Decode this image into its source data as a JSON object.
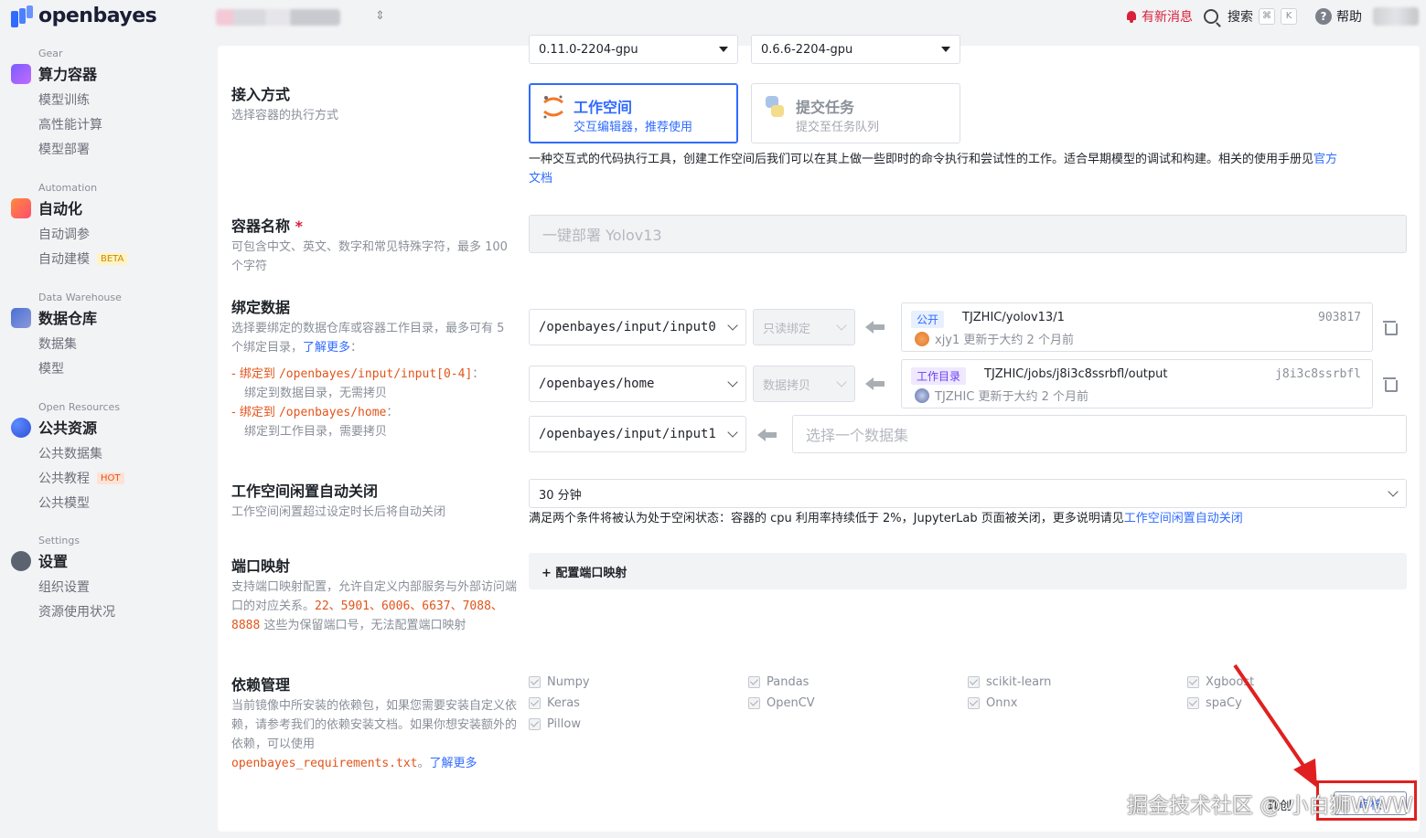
{
  "topbar": {
    "logo_text": "openbayes",
    "notify": "有新消息",
    "search": "搜索",
    "kbd_cmd": "⌘",
    "kbd_k": "K",
    "help": "帮助"
  },
  "sidebar": {
    "gear": {
      "caption": "Gear",
      "title": "算力容器",
      "items": [
        "模型训练",
        "高性能计算",
        "模型部署"
      ]
    },
    "automation": {
      "caption": "Automation",
      "title": "自动化",
      "items": [
        "自动调参",
        "自动建模"
      ],
      "beta": "BETA"
    },
    "warehouse": {
      "caption": "Data Warehouse",
      "title": "数据仓库",
      "items": [
        "数据集",
        "模型"
      ]
    },
    "open": {
      "caption": "Open Resources",
      "title": "公共资源",
      "items": [
        "公共数据集",
        "公共教程",
        "公共模型"
      ],
      "hot": "HOT"
    },
    "settings": {
      "caption": "Settings",
      "title": "设置",
      "items": [
        "组织设置",
        "资源使用状况"
      ]
    }
  },
  "form": {
    "versions": [
      "0.11.0-2204-gpu",
      "0.6.6-2204-gpu"
    ],
    "access": {
      "label": "接入方式",
      "desc": "选择容器的执行方式",
      "workspace_title": "工作空间",
      "workspace_sub": "交互编辑器，推荐使用",
      "task_title": "提交任务",
      "task_sub": "提交至任务队列",
      "note": "一种交互式的代码执行工具，创建工作空间后我们可以在其上做一些即时的命令执行和尝试性的工作。适合早期模型的调试和构建。相关的使用手册见",
      "note_link": "官方",
      "note_link2": "文档"
    },
    "name": {
      "label": "容器名称",
      "required": "*",
      "desc": "可包含中文、英文、数字和常见特殊字符，最多 100 个字符",
      "placeholder": "一键部署 Yolov13"
    },
    "bind": {
      "label": "绑定数据",
      "desc_1": "选择要绑定的数据仓库或容器工作目录，最多可有 5 个绑定目录，",
      "learn_more": "了解更多",
      "colon": "：",
      "rule1_prefix": "- 绑定到 ",
      "rule1_path": "/openbayes/input/input[0-4]",
      "rule1_suffix": "：",
      "rule1_desc": "绑定到数据目录，无需拷贝",
      "rule2_prefix": "- 绑定到 ",
      "rule2_path": "/openbayes/home",
      "rule2_suffix": "：",
      "rule2_desc": "绑定到工作目录，需要拷贝",
      "rows": [
        {
          "path": "/openbayes/input/input0",
          "mode": "只读绑定",
          "tag": "公开",
          "ds_path": "TJZHIC/yolov13/1",
          "ds_id": "903817",
          "meta": "xjy1 更新于大约 2 个月前"
        },
        {
          "path": "/openbayes/home",
          "mode": "数据拷贝",
          "tag": "工作目录",
          "ds_path": "TJZHIC/jobs/j8i3c8ssrbfl/output",
          "ds_id": "j8i3c8ssrbfl",
          "meta": "TJZHIC 更新于大约 2 个月前"
        }
      ],
      "empty_path": "/openbayes/input/input1",
      "empty_placeholder": "选择一个数据集"
    },
    "idle": {
      "label": "工作空间闲置自动关闭",
      "desc": "工作空间闲置超过设定时长后将自动关闭",
      "value": "30 分钟",
      "note": "满足两个条件将被认为处于空闲状态：容器的 cpu 利用率持续低于 2%，JupyterLab 页面被关闭，更多说明请见",
      "note_link": "工作空间闲置自动关闭"
    },
    "port": {
      "label": "端口映射",
      "desc_1": "支持端口映射配置，允许自定义内部服务与外部访问端口的对应关系。",
      "ports": "22、5901、6006、6637、7088、8888",
      "desc_2": " 这些为保留端口号，无法配置端口映射",
      "button": "+ 配置端口映射"
    },
    "deps": {
      "label": "依赖管理",
      "desc_1": "当前镜像中所安装的依赖包，如果您需要安装自定义依赖，请参考我们的依赖安装文档。如果你想安装额外的依赖，可以使用",
      "file": "openbayes_requirements.txt",
      "desc_2": "。",
      "learn_more": "了解更多",
      "col1": [
        "Numpy",
        "Keras",
        "Pillow"
      ],
      "col2": [
        "Pandas",
        "OpenCV"
      ],
      "col3": [
        "scikit-learn",
        "Onnx"
      ],
      "col4": [
        "Xgboost",
        "spaCy"
      ]
    }
  },
  "footer": {
    "create_cut": "现创",
    "create": "审核",
    "watermark": "掘金技术社区 @ 小白狮WWW"
  },
  "colors": {
    "accent": "#2f6bff",
    "danger": "#d9213b",
    "orange": "#e2541a",
    "annotation": "#e02020"
  }
}
